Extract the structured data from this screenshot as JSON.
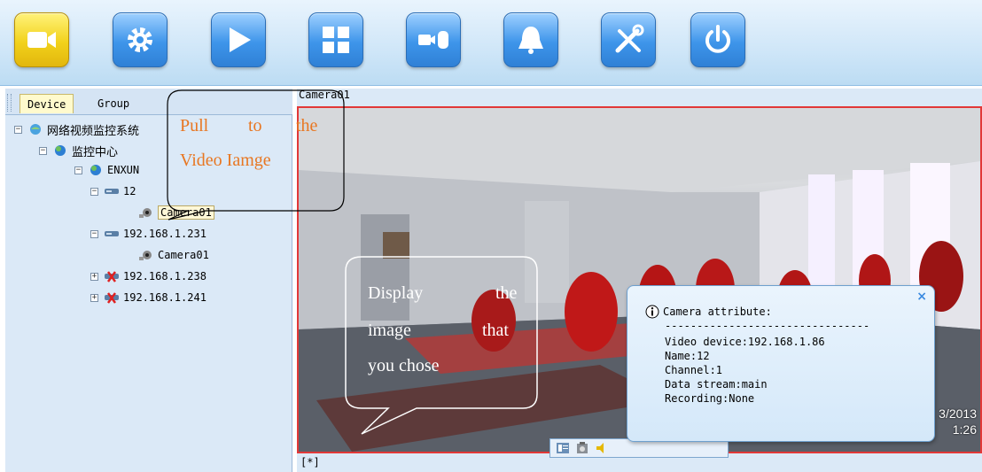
{
  "toolbar": {
    "buttons": [
      {
        "icon": "camera-icon",
        "active": true
      },
      {
        "icon": "gear-icon",
        "active": false
      },
      {
        "icon": "play-icon",
        "active": false
      },
      {
        "icon": "grid-icon",
        "active": false
      },
      {
        "icon": "record-icon",
        "active": false
      },
      {
        "icon": "bell-icon",
        "active": false
      },
      {
        "icon": "tools-icon",
        "active": false
      },
      {
        "icon": "power-icon",
        "active": false
      }
    ]
  },
  "left_panel": {
    "tabs": [
      "Device",
      "Group"
    ],
    "active_tab": "Device",
    "tree": {
      "root": "网络视频监控系统",
      "center": "监控中心",
      "enxun": "ENXUN",
      "dvr1": "12",
      "dvr1_camera": "Camera01",
      "dvr2": "192.168.1.231",
      "dvr2_camera": "Camera01",
      "dvr3": "192.168.1.238",
      "dvr4": "192.168.1.241"
    }
  },
  "video": {
    "title": "Camera01",
    "footer": "[*]",
    "overlay_date": "3/2013",
    "overlay_time": "1:26"
  },
  "attr_popup": {
    "title": "Camera attribute:",
    "separator": "--------------------------------",
    "lines": [
      "Video device:192.168.1.86",
      "Name:12",
      "Channel:1",
      "Data stream:main",
      "Recording:None"
    ],
    "close": "×"
  },
  "callouts": {
    "pull_line1": [
      "Pull",
      "to",
      "the"
    ],
    "pull_line2": "Video Iamge",
    "display_line1": [
      "Display",
      "the"
    ],
    "display_line2": [
      "image",
      "that"
    ],
    "display_line3": "you chose"
  },
  "colors": {
    "video_border": "#e23838",
    "callout_orange": "#e87722",
    "active_button": "#f2d21b",
    "button_blue": "#3e95ea"
  }
}
